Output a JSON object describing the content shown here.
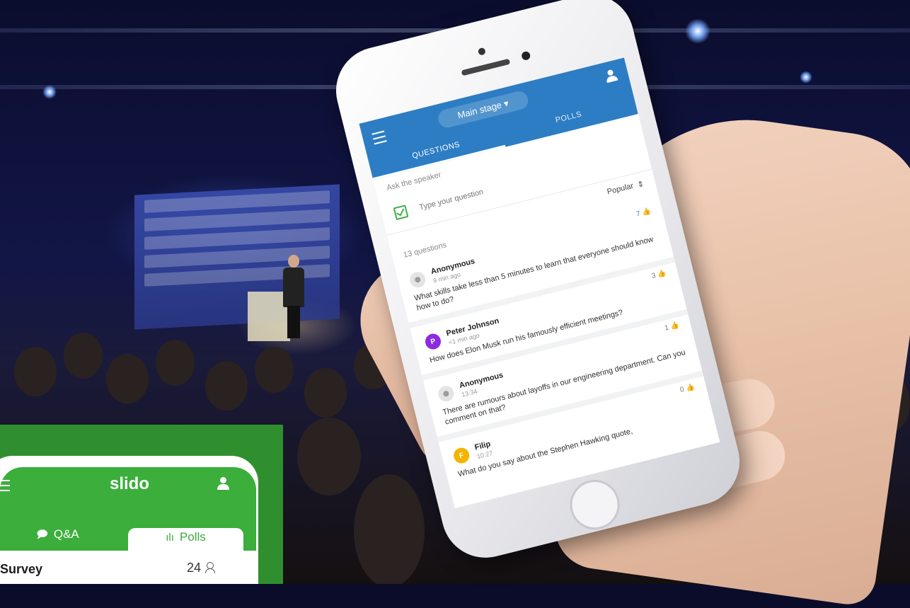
{
  "phone_app": {
    "stage_label": "Main stage",
    "stage_caret": "▾",
    "tabs": [
      "QUESTIONS",
      "POLLS"
    ],
    "ask_label": "Ask the speaker",
    "input_placeholder": "Type your question",
    "sort_label": "Popular",
    "sort_caret": "⇕",
    "question_count": "13 questions",
    "accent_color": "#2d7dc4",
    "questions": [
      {
        "likes": "7",
        "author": "Anonymous",
        "time": "9 min ago",
        "text": "What skills take less than 5 minutes to learn that everyone should know how to do?",
        "avatar": ""
      },
      {
        "likes": "3",
        "author": "Peter Johnson",
        "time": "<1 min ago",
        "text": "How does Elon Musk run his famously efficient meetings?",
        "avatar": "P"
      },
      {
        "likes": "1",
        "author": "Anonymous",
        "time": "13:34",
        "text": "There are rumours about layoffs in our engineering department. Can you comment on that?",
        "avatar": ""
      },
      {
        "likes": "0",
        "author": "Filip",
        "time": "10:27",
        "text": "What do you say about the Stephen Hawking quote,",
        "avatar": "F"
      }
    ]
  },
  "green_card": {
    "brand": "slido",
    "tabs": [
      {
        "icon": "chat-icon",
        "glyph": "🗩",
        "label": "Q&A"
      },
      {
        "icon": "bar-chart-icon",
        "glyph": "ılı",
        "label": "Polls"
      }
    ],
    "survey_label": "Survey",
    "participants": "24",
    "brand_color": "#3bae3b"
  }
}
